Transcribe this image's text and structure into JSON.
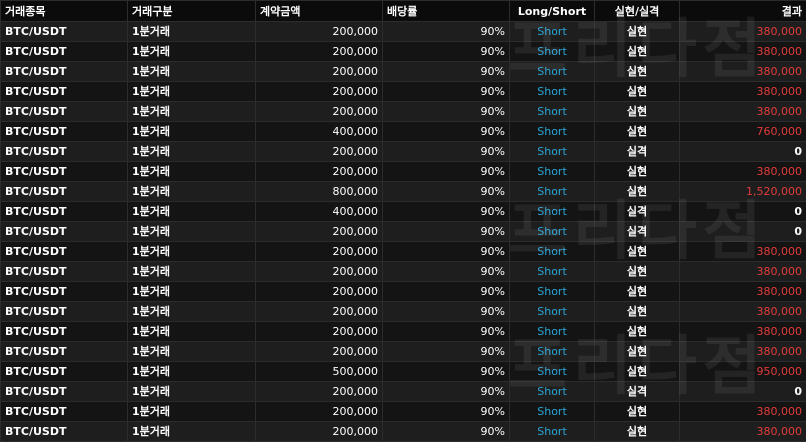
{
  "columns": [
    "거래종목",
    "거래구분",
    "계약금액",
    "배당률",
    "Long/Short",
    "실현/실격",
    "결과"
  ],
  "watermark": "프리다점",
  "colors": {
    "short": "#2aa5d6",
    "win": "#e33b3b",
    "row_odd": "#1e1e1e",
    "row_even": "#141414"
  },
  "rows": [
    {
      "symbol": "BTC/USDT",
      "kind": "1분거래",
      "amount": "200,000",
      "rate": "90%",
      "side": "Short",
      "status": "실현",
      "result": "380,000"
    },
    {
      "symbol": "BTC/USDT",
      "kind": "1분거래",
      "amount": "200,000",
      "rate": "90%",
      "side": "Short",
      "status": "실현",
      "result": "380,000"
    },
    {
      "symbol": "BTC/USDT",
      "kind": "1분거래",
      "amount": "200,000",
      "rate": "90%",
      "side": "Short",
      "status": "실현",
      "result": "380,000"
    },
    {
      "symbol": "BTC/USDT",
      "kind": "1분거래",
      "amount": "200,000",
      "rate": "90%",
      "side": "Short",
      "status": "실현",
      "result": "380,000"
    },
    {
      "symbol": "BTC/USDT",
      "kind": "1분거래",
      "amount": "200,000",
      "rate": "90%",
      "side": "Short",
      "status": "실현",
      "result": "380,000"
    },
    {
      "symbol": "BTC/USDT",
      "kind": "1분거래",
      "amount": "400,000",
      "rate": "90%",
      "side": "Short",
      "status": "실현",
      "result": "760,000"
    },
    {
      "symbol": "BTC/USDT",
      "kind": "1분거래",
      "amount": "200,000",
      "rate": "90%",
      "side": "Short",
      "status": "실격",
      "result": "0"
    },
    {
      "symbol": "BTC/USDT",
      "kind": "1분거래",
      "amount": "200,000",
      "rate": "90%",
      "side": "Short",
      "status": "실현",
      "result": "380,000"
    },
    {
      "symbol": "BTC/USDT",
      "kind": "1분거래",
      "amount": "800,000",
      "rate": "90%",
      "side": "Short",
      "status": "실현",
      "result": "1,520,000"
    },
    {
      "symbol": "BTC/USDT",
      "kind": "1분거래",
      "amount": "400,000",
      "rate": "90%",
      "side": "Short",
      "status": "실격",
      "result": "0"
    },
    {
      "symbol": "BTC/USDT",
      "kind": "1분거래",
      "amount": "200,000",
      "rate": "90%",
      "side": "Short",
      "status": "실격",
      "result": "0"
    },
    {
      "symbol": "BTC/USDT",
      "kind": "1분거래",
      "amount": "200,000",
      "rate": "90%",
      "side": "Short",
      "status": "실현",
      "result": "380,000"
    },
    {
      "symbol": "BTC/USDT",
      "kind": "1분거래",
      "amount": "200,000",
      "rate": "90%",
      "side": "Short",
      "status": "실현",
      "result": "380,000"
    },
    {
      "symbol": "BTC/USDT",
      "kind": "1분거래",
      "amount": "200,000",
      "rate": "90%",
      "side": "Short",
      "status": "실현",
      "result": "380,000"
    },
    {
      "symbol": "BTC/USDT",
      "kind": "1분거래",
      "amount": "200,000",
      "rate": "90%",
      "side": "Short",
      "status": "실현",
      "result": "380,000"
    },
    {
      "symbol": "BTC/USDT",
      "kind": "1분거래",
      "amount": "200,000",
      "rate": "90%",
      "side": "Short",
      "status": "실현",
      "result": "380,000"
    },
    {
      "symbol": "BTC/USDT",
      "kind": "1분거래",
      "amount": "200,000",
      "rate": "90%",
      "side": "Short",
      "status": "실현",
      "result": "380,000"
    },
    {
      "symbol": "BTC/USDT",
      "kind": "1분거래",
      "amount": "500,000",
      "rate": "90%",
      "side": "Short",
      "status": "실현",
      "result": "950,000"
    },
    {
      "symbol": "BTC/USDT",
      "kind": "1분거래",
      "amount": "200,000",
      "rate": "90%",
      "side": "Short",
      "status": "실격",
      "result": "0"
    },
    {
      "symbol": "BTC/USDT",
      "kind": "1분거래",
      "amount": "200,000",
      "rate": "90%",
      "side": "Short",
      "status": "실현",
      "result": "380,000"
    },
    {
      "symbol": "BTC/USDT",
      "kind": "1분거래",
      "amount": "200,000",
      "rate": "90%",
      "side": "Short",
      "status": "실현",
      "result": "380,000"
    }
  ]
}
